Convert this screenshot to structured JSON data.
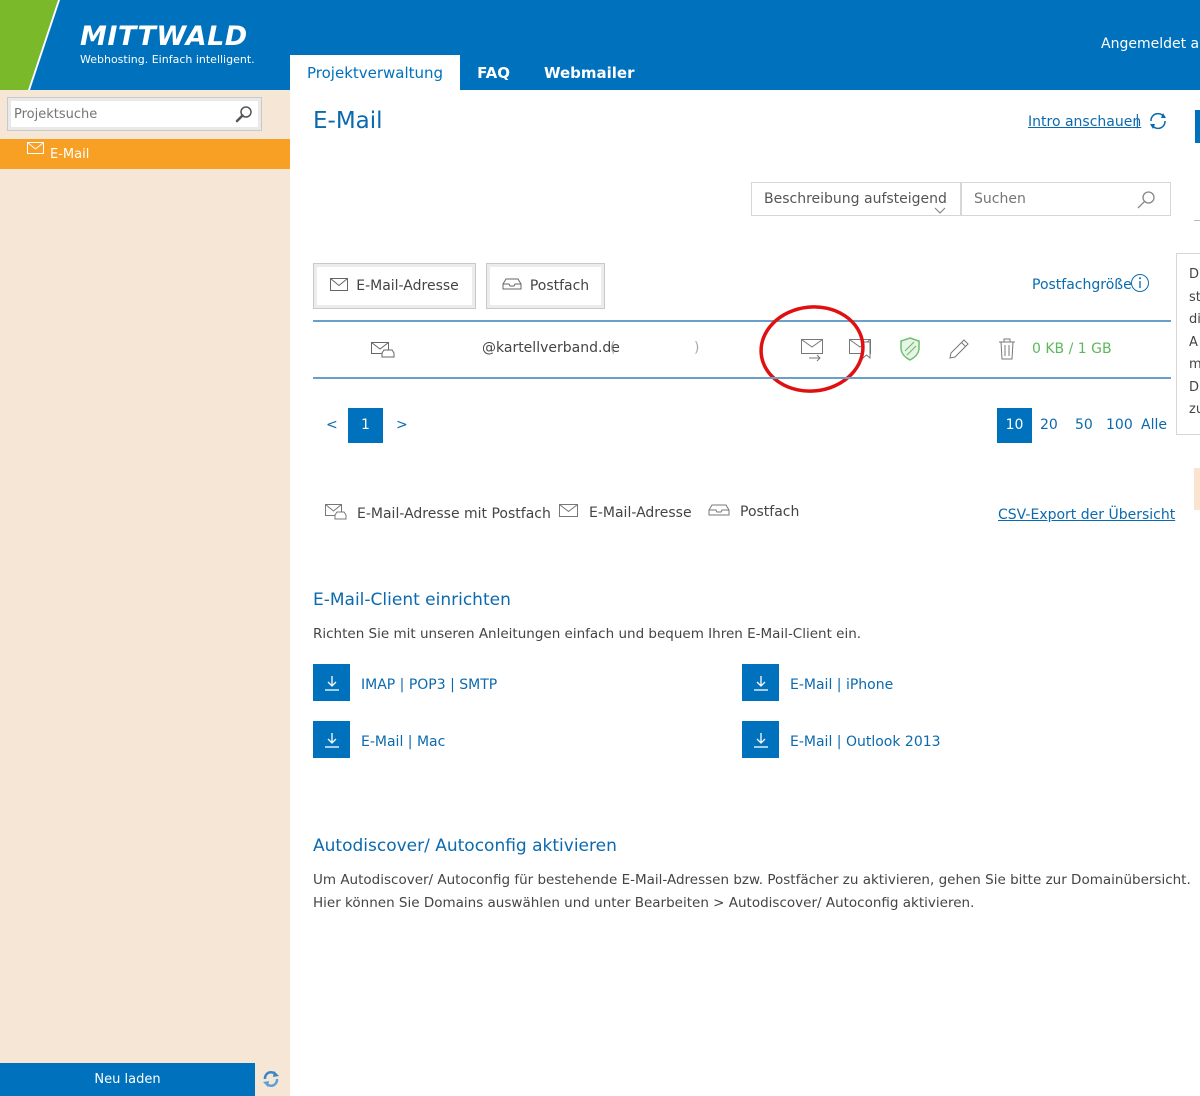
{
  "header": {
    "logo_name": "MITTWALD",
    "logo_tagline": "Webhosting. Einfach intelligent.",
    "login_text": "Angemeldet als",
    "tabs": [
      {
        "label": "Projektverwaltung",
        "active": true
      },
      {
        "label": "FAQ",
        "active": false
      },
      {
        "label": "Webmailer",
        "active": false
      }
    ]
  },
  "sidebar": {
    "search_placeholder": "Projektsuche",
    "items": [
      {
        "label": "E-Mail",
        "icon": "envelope-icon",
        "active": true
      }
    ],
    "reload_label": "Neu laden"
  },
  "main": {
    "title": "E-Mail",
    "intro_link": "Intro anschauen",
    "intro_separator": "|",
    "sort_label": "Beschreibung aufsteigend",
    "search_placeholder": "Suchen",
    "btn_email_address": "E-Mail-Adresse",
    "btn_postfach": "Postfach",
    "mailbox_size_label": "Postfachgröße",
    "row": {
      "address": "@kartellverband.de",
      "paren_open": "(",
      "paren_close": ")",
      "size": "0 KB / 1 GB",
      "actions": [
        "forward-mail-icon",
        "autoresponder-icon",
        "spam-shield-icon",
        "edit-pencil-icon",
        "trash-icon"
      ]
    },
    "pagination": {
      "prev": "<",
      "current": "1",
      "next": ">"
    },
    "per_page": [
      {
        "label": "10",
        "active": true
      },
      {
        "label": "20",
        "active": false
      },
      {
        "label": "50",
        "active": false
      },
      {
        "label": "100",
        "active": false
      },
      {
        "label": "Alle",
        "active": false
      }
    ],
    "legend": {
      "mail_with_box": "E-Mail-Adresse mit Postfach",
      "mail_address": "E-Mail-Adresse",
      "postfach": "Postfach"
    },
    "csv_export": "CSV-Export der Übersicht",
    "client_setup": {
      "title": "E-Mail-Client einrichten",
      "text": "Richten Sie mit unseren Anleitungen einfach und bequem Ihren E-Mail-Client ein.",
      "downloads": [
        "IMAP | POP3 | SMTP",
        "E-Mail | iPhone",
        "E-Mail | Mac",
        "E-Mail | Outlook 2013"
      ]
    },
    "autodiscover": {
      "title": "Autodiscover/ Autoconfig aktivieren",
      "line1": "Um Autodiscover/ Autoconfig für bestehende E-Mail-Adressen bzw. Postfächer zu aktivieren, gehen Sie bitte zur Domainübersicht.",
      "line2": "Hier können Sie Domains auswählen und unter Bearbeiten > Autodiscover/ Autoconfig aktivieren."
    },
    "side_panel_letters": [
      "D",
      "st",
      "di",
      "A",
      "m",
      "D",
      "zu"
    ]
  },
  "colors": {
    "brand_blue": "#0071bc",
    "link_blue": "#0b6aae",
    "sidebar_bg": "#f5e6d6",
    "active_orange": "#f7a023",
    "brand_green": "#7ab929",
    "size_green": "#5cb85c",
    "annotation_red": "#e01010"
  }
}
